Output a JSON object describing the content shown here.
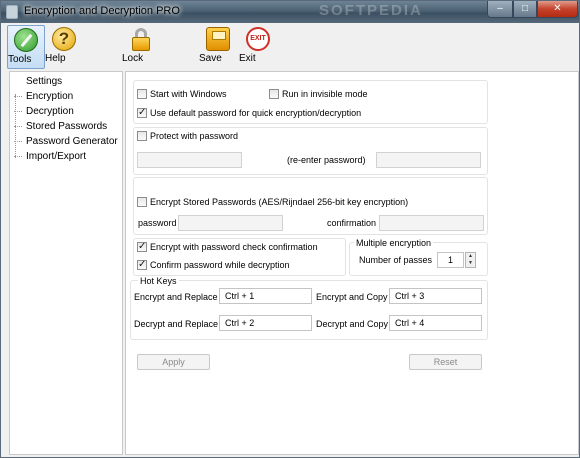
{
  "window": {
    "title": "Encryption and Decryption PRO",
    "watermark": "SOFTPEDIA"
  },
  "toolbar": {
    "tools": "Tools",
    "help": "Help",
    "lock": "Lock",
    "save": "Save",
    "exit": "Exit",
    "exit_icon_text": "EXIT",
    "help_icon_text": "?"
  },
  "sidebar": {
    "items": [
      {
        "label": "Settings"
      },
      {
        "label": "Encryption"
      },
      {
        "label": "Decryption"
      },
      {
        "label": "Stored Passwords"
      },
      {
        "label": "Password Generator"
      },
      {
        "label": "Import/Export"
      }
    ]
  },
  "settings": {
    "start_with_windows": "Start with Windows",
    "run_invisible": "Run in invisible mode",
    "use_default_password": "Use default password for quick encryption/decryption",
    "protect_with_password": "Protect with password",
    "reenter_password": "(re-enter password)",
    "encrypt_stored": "Encrypt Stored Passwords (AES/Rijndael 256-bit key encryption)",
    "password_label": "password",
    "confirmation_label": "confirmation",
    "encrypt_check_confirm": "Encrypt with password check confirmation",
    "confirm_while_decrypt": "Confirm password while decryption",
    "multiple_encryption": "Multiple encryption",
    "number_of_passes": "Number of passes",
    "passes_value": "1",
    "hot_keys": "Hot Keys",
    "encrypt_replace": "Encrypt and Replace",
    "encrypt_replace_key": "Ctrl + 1",
    "encrypt_copy": "Encrypt and Copy",
    "encrypt_copy_key": "Ctrl + 3",
    "decrypt_replace": "Decrypt and Replace",
    "decrypt_replace_key": "Ctrl + 2",
    "decrypt_copy": "Decrypt and Copy",
    "decrypt_copy_key": "Ctrl + 4",
    "apply": "Apply",
    "reset": "Reset"
  }
}
